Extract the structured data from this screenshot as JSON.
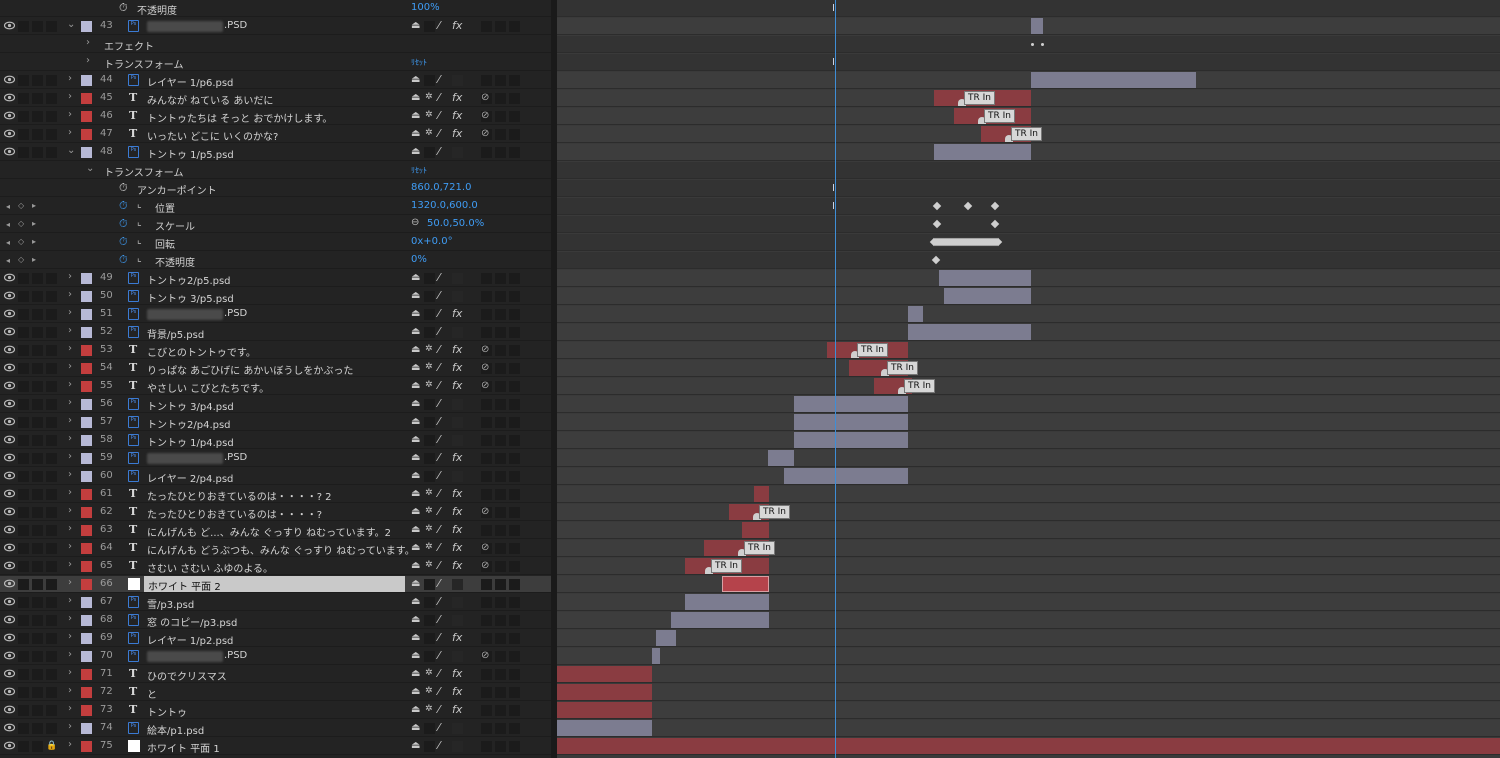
{
  "colors": {
    "gray_label": "#b7b9d6",
    "red_label": "#c33e3e",
    "blue_value": "#3f9cf4",
    "bar_gray": "#7c7c90",
    "bar_red": "#8a3c41",
    "playhead": "#3f8ed6"
  },
  "header_row": {
    "prop": "不透明度",
    "value": "100%"
  },
  "layers_top": [
    {
      "num": "43",
      "name": ".PSD",
      "blur": true,
      "label": "gray",
      "type": "psd",
      "expanded": true,
      "fx": true,
      "motion": false
    }
  ],
  "effect_row": {
    "label": "エフェクト"
  },
  "transform_row_43": {
    "label": "トランスフォーム",
    "reset": "ﾘｾｯﾄ"
  },
  "layers_a": [
    {
      "num": "44",
      "name": "レイヤー 1/p6.psd",
      "label": "gray",
      "type": "psd",
      "fx": false,
      "motion": false
    },
    {
      "num": "45",
      "name": "みんなが ねている あいだに",
      "label": "red",
      "type": "T",
      "fx": true,
      "motion": true
    },
    {
      "num": "46",
      "name": "トントゥたちは そっと おでかけします。",
      "label": "red",
      "type": "T",
      "fx": true,
      "motion": true
    },
    {
      "num": "47",
      "name": "いったい どこに いくのかな?",
      "label": "red",
      "type": "T",
      "fx": true,
      "motion": true
    },
    {
      "num": "48",
      "name": "トントゥ 1/p5.psd",
      "label": "gray",
      "type": "psd",
      "fx": false,
      "motion": false,
      "expanded": true
    }
  ],
  "transform_48": {
    "label": "トランスフォーム",
    "reset": "ﾘｾｯﾄ",
    "props": [
      {
        "name": "アンカーポイント",
        "value": "860.0,721.0",
        "animated": false
      },
      {
        "name": "位置",
        "value": "1320.0,600.0",
        "animated": true
      },
      {
        "name": "スケール",
        "value": "50.0,50.0%",
        "animated": true,
        "link": true
      },
      {
        "name": "回転",
        "value": "0x+0.0°",
        "animated": true
      },
      {
        "name": "不透明度",
        "value": "0%",
        "animated": true
      }
    ]
  },
  "layers_b": [
    {
      "num": "49",
      "name": "トントゥ2/p5.psd",
      "label": "gray",
      "type": "psd",
      "fx": false,
      "motion": false
    },
    {
      "num": "50",
      "name": "トントゥ 3/p5.psd",
      "label": "gray",
      "type": "psd",
      "fx": false,
      "motion": false
    },
    {
      "num": "51",
      "name": ".PSD",
      "blur": true,
      "label": "gray",
      "type": "psd",
      "fx": true,
      "motion": false
    },
    {
      "num": "52",
      "name": "背景/p5.psd",
      "label": "gray",
      "type": "psd",
      "fx": false,
      "motion": false
    },
    {
      "num": "53",
      "name": "こびとのトントゥです。",
      "label": "red",
      "type": "T",
      "fx": true,
      "motion": true
    },
    {
      "num": "54",
      "name": "りっぱな あごひげに あかいぼうしをかぶった",
      "label": "red",
      "type": "T",
      "fx": true,
      "motion": true
    },
    {
      "num": "55",
      "name": "やさしい こびとたちです。",
      "label": "red",
      "type": "T",
      "fx": true,
      "motion": true
    },
    {
      "num": "56",
      "name": "トントゥ 3/p4.psd",
      "label": "gray",
      "type": "psd",
      "fx": false,
      "motion": false
    },
    {
      "num": "57",
      "name": "トントゥ2/p4.psd",
      "label": "gray",
      "type": "psd",
      "fx": false,
      "motion": false
    },
    {
      "num": "58",
      "name": "トントゥ 1/p4.psd",
      "label": "gray",
      "type": "psd",
      "fx": false,
      "motion": false
    },
    {
      "num": "59",
      "name": ".PSD",
      "blur": true,
      "label": "gray",
      "type": "psd",
      "fx": true,
      "motion": false
    },
    {
      "num": "60",
      "name": "レイヤー 2/p4.psd",
      "label": "gray",
      "type": "psd",
      "fx": false,
      "motion": false
    },
    {
      "num": "61",
      "name": "たったひとりおきているのは・・・・? 2",
      "label": "red",
      "type": "T",
      "fx": true,
      "motion": false
    },
    {
      "num": "62",
      "name": "たったひとりおきているのは・・・・?",
      "label": "red",
      "type": "T",
      "fx": true,
      "motion": true
    },
    {
      "num": "63",
      "name": "にんげんも ど...、みんな ぐっすり ねむっています。2",
      "label": "red",
      "type": "T",
      "fx": true,
      "motion": false
    },
    {
      "num": "64",
      "name": "にんげんも どうぶつも、みんな ぐっすり ねむっています。",
      "label": "red",
      "type": "T",
      "fx": true,
      "motion": true
    },
    {
      "num": "65",
      "name": "さむい さむい ふゆのよる。",
      "label": "red",
      "type": "T",
      "fx": true,
      "motion": true
    },
    {
      "num": "66",
      "name": "ホワイト 平面 2",
      "label": "red",
      "type": "white",
      "fx": false,
      "motion": false,
      "selected": true
    },
    {
      "num": "67",
      "name": "雪/p3.psd",
      "label": "gray",
      "type": "psd",
      "fx": false,
      "motion": false
    },
    {
      "num": "68",
      "name": "窓 のコピー/p3.psd",
      "label": "gray",
      "type": "psd",
      "fx": false,
      "motion": false
    },
    {
      "num": "69",
      "name": "レイヤー 1/p2.psd",
      "label": "gray",
      "type": "psd",
      "fx": true,
      "motion": false
    },
    {
      "num": "70",
      "name": ".PSD",
      "blur": true,
      "label": "gray",
      "type": "psd",
      "fx": false,
      "motion": true
    },
    {
      "num": "71",
      "name": "ひのでクリスマス",
      "label": "red",
      "type": "T",
      "fx": true,
      "motion": false
    },
    {
      "num": "72",
      "name": "と",
      "label": "red",
      "type": "T",
      "fx": true,
      "motion": false
    },
    {
      "num": "73",
      "name": "トントゥ",
      "label": "red",
      "type": "T",
      "fx": true,
      "motion": false
    },
    {
      "num": "74",
      "name": "絵本/p1.psd",
      "label": "gray",
      "type": "psd",
      "fx": false,
      "motion": false
    },
    {
      "num": "75",
      "name": "ホワイト 平面 1",
      "label": "red",
      "type": "white",
      "fx": false,
      "motion": false,
      "locked": true
    }
  ],
  "timeline": {
    "marker_text": "TR In",
    "icon_psd": "Ps",
    "icon_stopwatch": "stopwatch-icon"
  }
}
